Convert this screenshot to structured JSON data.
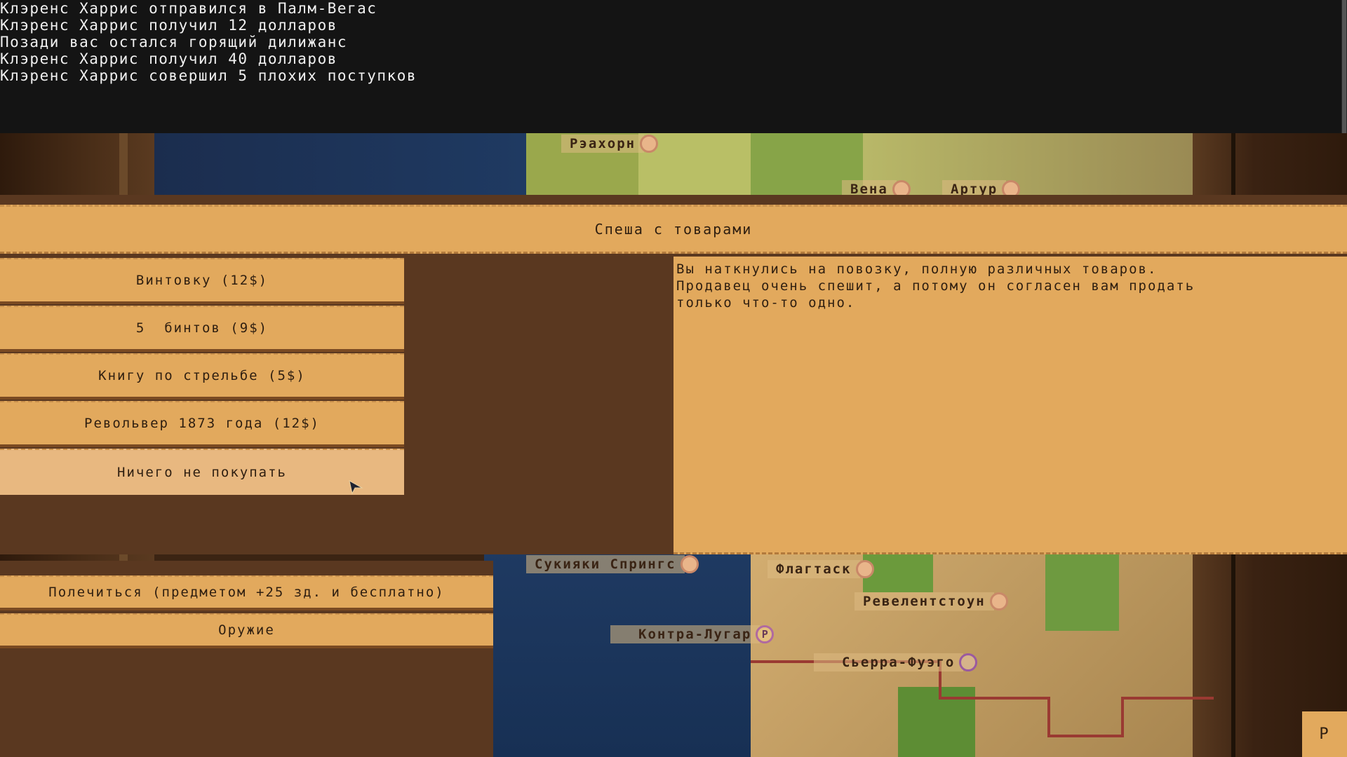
{
  "log": {
    "lines": [
      "Клэренс Харрис отправился в Палм-Вегас",
      "Клэренс Харрис получил 12 долларов",
      "Позади вас остался горящий дилижанс",
      "Клэренс Харрис получил 40 долларов",
      "Клэренс Харрис совершил 5 плохих поступков"
    ]
  },
  "event": {
    "title": "Спеша с товарами",
    "description": "Вы наткнулись на повозку, полную различных товаров.\nПродавец очень спешит, а потому он согласен вам продать\nтолько что-то одно.",
    "options": [
      "Винтовку (12$)",
      "5  бинтов (9$)",
      "Книгу по стрельбе (5$)",
      "Револьвер 1873 года (12$)",
      "Ничего не покупать"
    ]
  },
  "actions": {
    "heal": "Полечиться (предметом +25 зд. и бесплатно)",
    "weapons": "Оружие"
  },
  "map": {
    "towns": [
      {
        "name": "Рэахорн",
        "marker": ""
      },
      {
        "name": "Вена",
        "marker": ""
      },
      {
        "name": "Артур",
        "marker": ""
      },
      {
        "name": "Сукияки Спрингс",
        "marker": ""
      },
      {
        "name": "Флагтаск",
        "marker": ""
      },
      {
        "name": "Ревелентстоун",
        "marker": ""
      },
      {
        "name": "Контра-Лугар",
        "marker": "P"
      },
      {
        "name": "Сьерра-Фуэго",
        "marker": ""
      }
    ],
    "corner_button": "P"
  },
  "colors": {
    "panel": "#e2a95d",
    "ocean": "#1e3558",
    "grass": "#5d8d34",
    "sand": "#caa56a",
    "wood": "#3b2413"
  }
}
